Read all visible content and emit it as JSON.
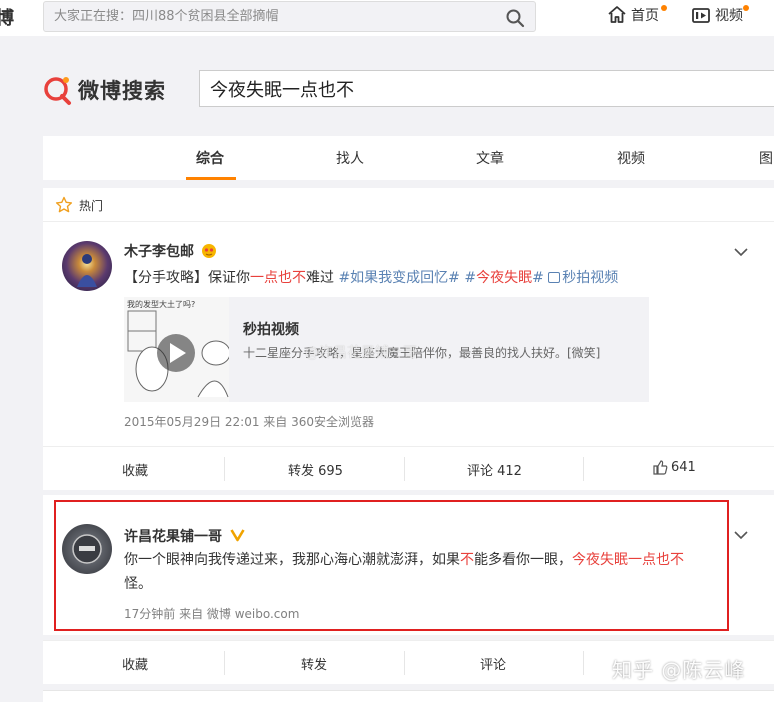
{
  "topbar": {
    "brand_fragment": "博",
    "search_placeholder": "大家正在搜：四川88个贫困县全部摘帽",
    "nav": [
      {
        "label": "首页",
        "icon": "home-icon"
      },
      {
        "label": "视频",
        "icon": "video-icon"
      }
    ],
    "accent": "#ff8200"
  },
  "search": {
    "logo_text": "微博搜索",
    "query": "今夜失眠一点也不"
  },
  "tabs": [
    {
      "label": "综合",
      "active": true
    },
    {
      "label": "找人",
      "active": false
    },
    {
      "label": "文章",
      "active": false
    },
    {
      "label": "视频",
      "active": false
    },
    {
      "label": "图",
      "active": false
    }
  ],
  "hot_section": {
    "label": "热门"
  },
  "post1": {
    "author": "木子李包邮",
    "text_parts": {
      "p1": "【分手攻略】保证你",
      "p2": "一点也不",
      "p3": "难过 ",
      "p4": "#如果我变成回忆#",
      "p5": " #",
      "p6": "今夜失眠",
      "p7": "# ",
      "p8": "秒拍视频"
    },
    "video": {
      "thumb_caption": "我的发型大土了吗?",
      "title": "秒拍视频",
      "desc": "十二星座分手攻略，星座大魔王陪伴你，最善良的找人扶好。[微笑]"
    },
    "meta": "2015年05月29日 22:01  来自 360安全浏览器",
    "actions": {
      "favorite": "收藏",
      "repost": "转发 695",
      "comment": "评论 412",
      "like": "641"
    }
  },
  "post2": {
    "author": "许昌花果铺一哥",
    "line1": {
      "a": "你一个眼神向我传递过来，我那心海心潮就澎湃，如果",
      "b": "不",
      "c": "能多看你一眼，",
      "d": "今夜失眠一点也不"
    },
    "line2": "怪。",
    "meta": "17分钟前  来自 微博 weibo.com",
    "actions": {
      "favorite": "收藏",
      "repost": "转发",
      "comment": "评论"
    }
  },
  "watermarks": {
    "corner": "知乎 @陈云峰",
    "overlay": "@许昌花果铺一哥"
  }
}
